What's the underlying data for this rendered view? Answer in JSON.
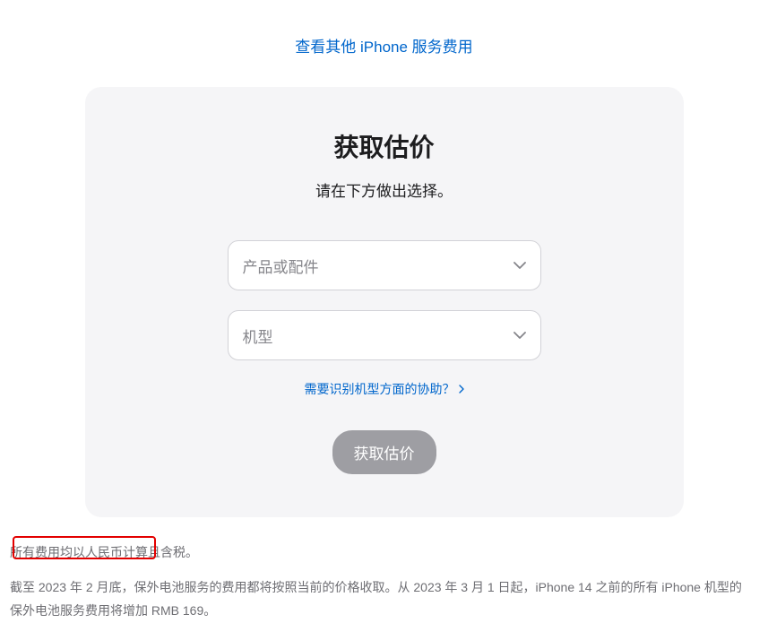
{
  "topLink": "查看其他 iPhone 服务费用",
  "card": {
    "title": "获取估价",
    "subtitle": "请在下方做出选择。",
    "select1": "产品或配件",
    "select2": "机型",
    "helpLink": "需要识别机型方面的协助？",
    "submitButton": "获取估价"
  },
  "disclaimer": {
    "p1": "所有费用均以人民币计算且含税。",
    "p2": "截至 2023 年 2 月底，保外电池服务的费用都将按照当前的价格收取。从 2023 年 3 月 1 日起，iPhone 14 之前的所有 iPhone 机型的保外电池服务费用将增加 RMB 169。"
  }
}
